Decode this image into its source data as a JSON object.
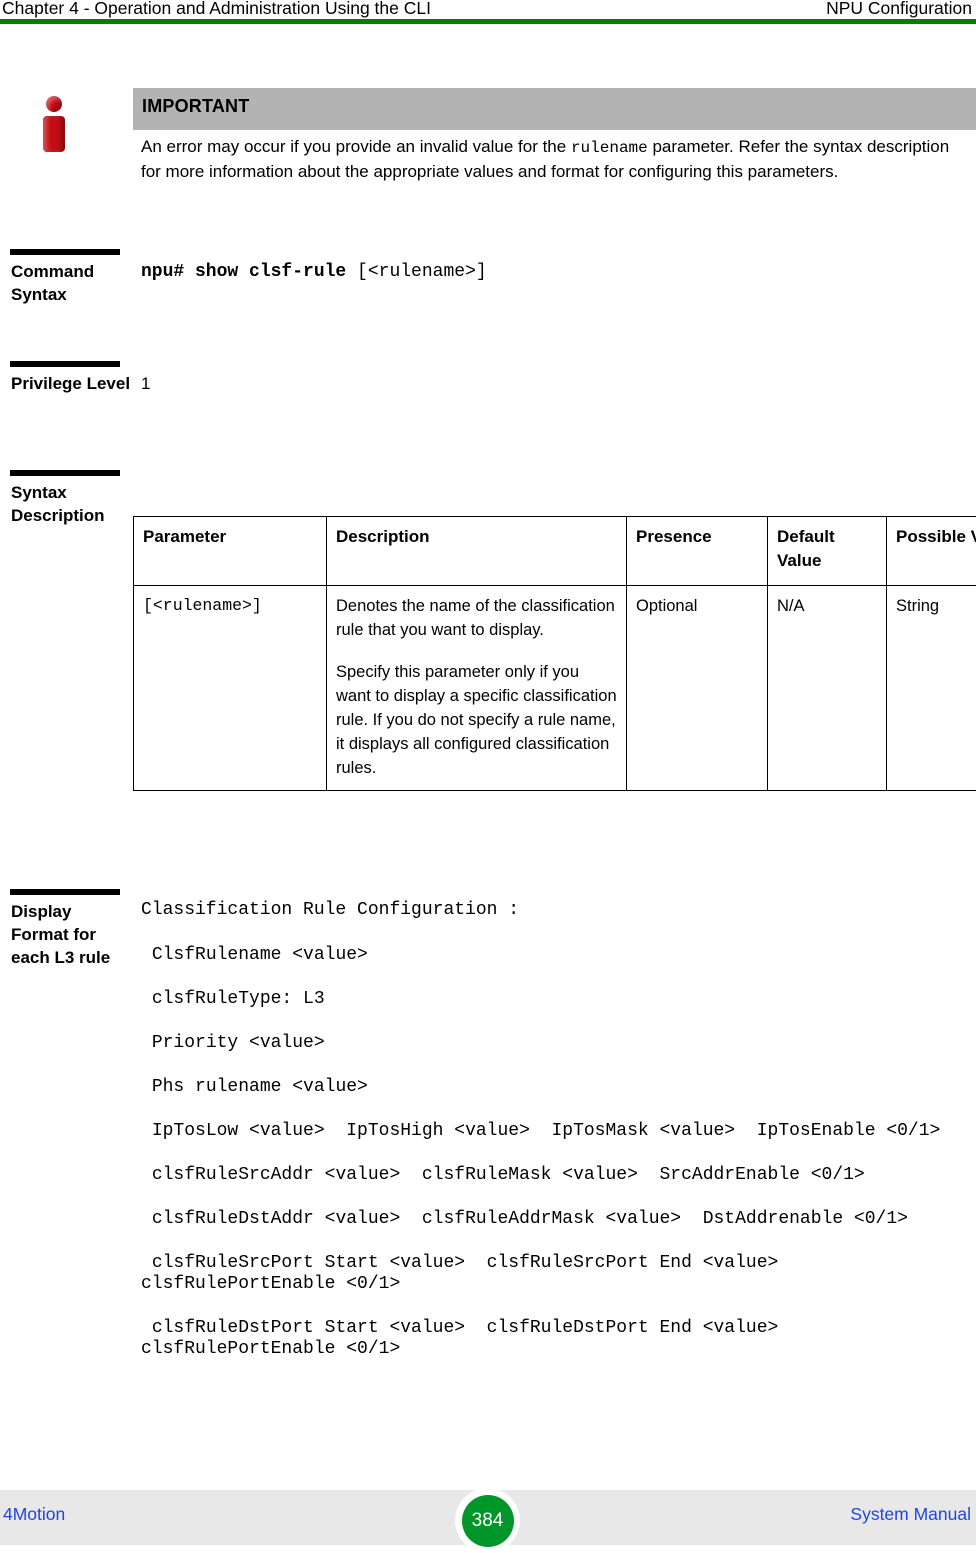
{
  "header": {
    "left": "Chapter 4 - Operation and Administration Using the CLI",
    "right": "NPU Configuration",
    "rule_color": "#008000"
  },
  "callout": {
    "icon": "info-icon",
    "title": "IMPORTANT",
    "bar_color": "#b3b3b3",
    "icon_color": "#c40d14",
    "body_prefix": "An error may occur if you provide an invalid value for the ",
    "body_mono": "rulename",
    "body_suffix": " parameter. Refer the syntax description for more information about the appropriate values and format for configuring this parameters."
  },
  "command_syntax": {
    "label": "Command Syntax",
    "prompt": "npu# show clsf-rule",
    "argument": "[<rulename>]"
  },
  "privilege_level": {
    "label": "Privilege Level",
    "value": "1"
  },
  "syntax_description": {
    "label": "Syntax Description",
    "columns": [
      "Parameter",
      "Description",
      "Presence",
      "Default Value",
      "Possible Values"
    ],
    "rows": [
      {
        "parameter": "[<rulename>]",
        "description_paragraphs": [
          "Denotes the name of the classification rule that you want to display.",
          "Specify this parameter only if you want to display a specific classification rule. If you do not specify a rule name, it displays all configured classification rules."
        ],
        "presence": "Optional",
        "default_value": "N/A",
        "possible_values": "String"
      }
    ]
  },
  "display_format": {
    "label": "Display Format for each L3 rule",
    "lines": [
      "Classification Rule Configuration :",
      " ClsfRulename <value>",
      " clsfRuleType: L3",
      " Priority <value>",
      " Phs rulename <value>",
      " IpTosLow <value>  IpTosHigh <value>  IpTosMask <value>  IpTosEnable <0/1>",
      " clsfRuleSrcAddr <value>  clsfRuleMask <value>  SrcAddrEnable <0/1>",
      " clsfRuleDstAddr <value>  clsfRuleAddrMask <value>  DstAddrenable <0/1>",
      " clsfRuleSrcPort Start <value>  clsfRuleSrcPort End <value> clsfRulePortEnable <0/1>",
      " clsfRuleDstPort Start <value>  clsfRuleDstPort End <value> clsfRulePortEnable <0/1>"
    ]
  },
  "footer": {
    "left": "4Motion",
    "page_number": "384",
    "right": "System Manual",
    "link_color": "#1f46e0",
    "badge_color": "#00962a"
  }
}
